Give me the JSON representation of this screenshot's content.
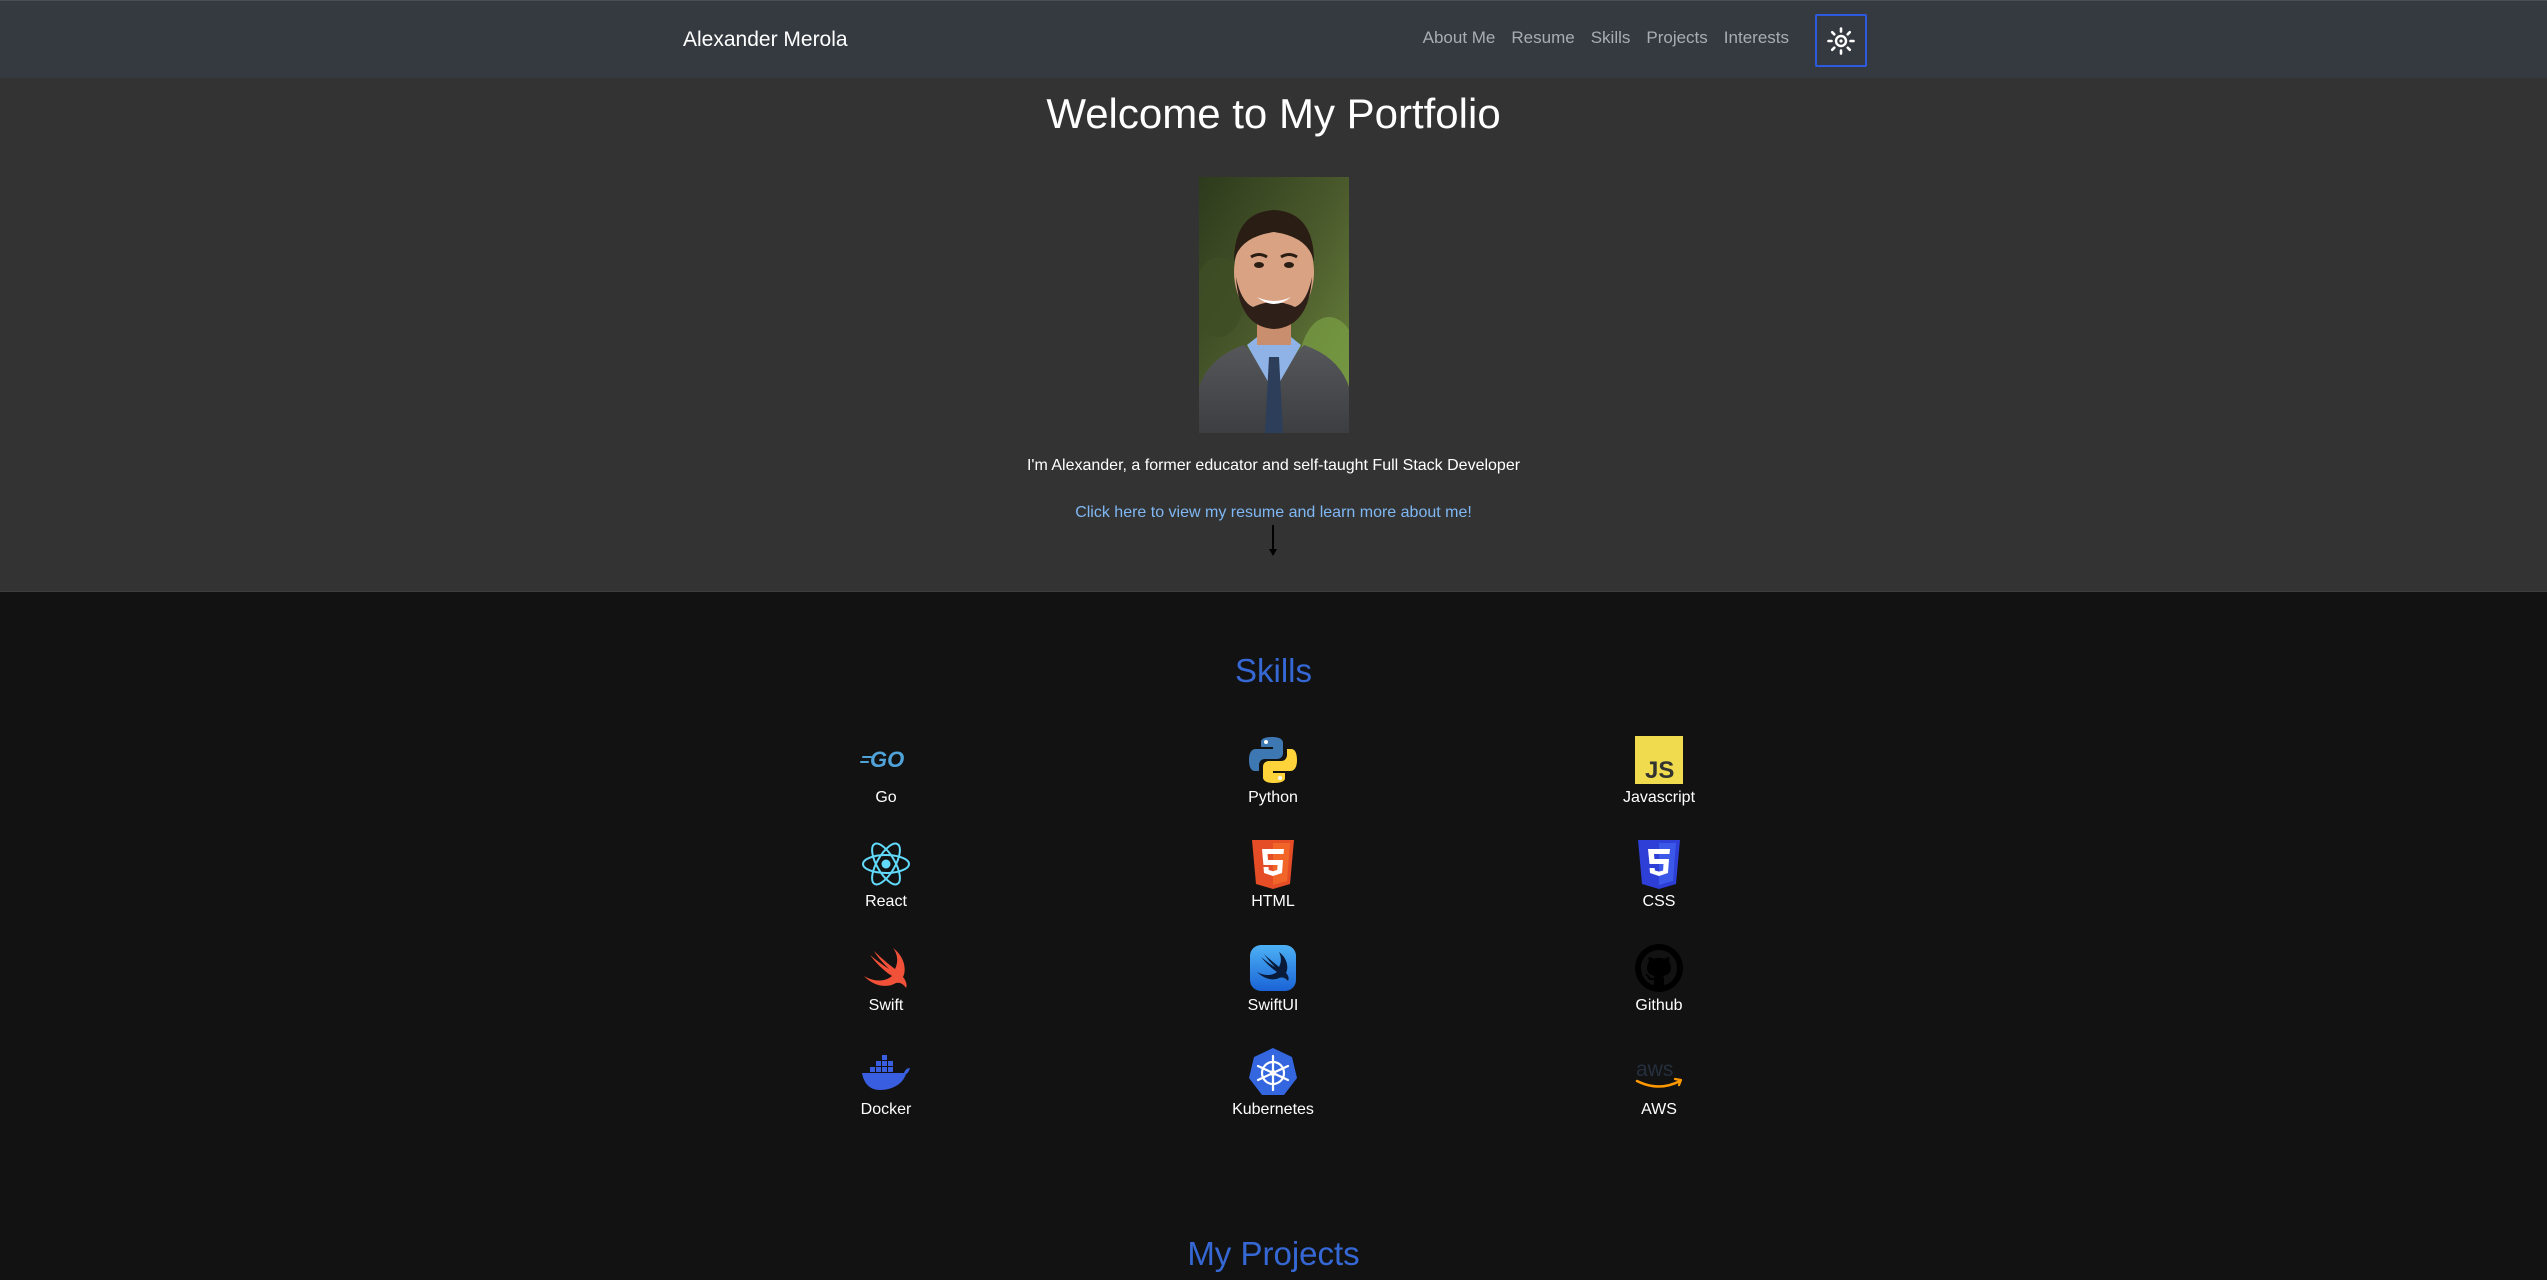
{
  "nav": {
    "brand": "Alexander Merola",
    "links": [
      "About Me",
      "Resume",
      "Skills",
      "Projects",
      "Interests"
    ],
    "theme_toggle_icon": "sun-icon"
  },
  "hero": {
    "title": "Welcome to My Portfolio",
    "tagline": "I'm Alexander, a former educator and self-taught Full Stack Developer",
    "link": "Click here to view my resume and learn more about me!"
  },
  "skills": {
    "title": "Skills",
    "items": [
      {
        "label": "Go",
        "icon": "go-icon"
      },
      {
        "label": "Python",
        "icon": "python-icon"
      },
      {
        "label": "Javascript",
        "icon": "javascript-icon"
      },
      {
        "label": "React",
        "icon": "react-icon"
      },
      {
        "label": "HTML",
        "icon": "html5-icon"
      },
      {
        "label": "CSS",
        "icon": "css3-icon"
      },
      {
        "label": "Swift",
        "icon": "swift-icon"
      },
      {
        "label": "SwiftUI",
        "icon": "swiftui-icon"
      },
      {
        "label": "Github",
        "icon": "github-icon"
      },
      {
        "label": "Docker",
        "icon": "docker-icon"
      },
      {
        "label": "Kubernetes",
        "icon": "kubernetes-icon"
      },
      {
        "label": "AWS",
        "icon": "aws-icon"
      }
    ]
  },
  "projects": {
    "title": "My Projects"
  },
  "colors": {
    "navbar_bg": "#343a40",
    "hero_bg": "#333333",
    "page_bg": "#121212",
    "section_title": "#3568d4",
    "link": "#7fb8f5",
    "toggle_border": "#2d5be0"
  }
}
